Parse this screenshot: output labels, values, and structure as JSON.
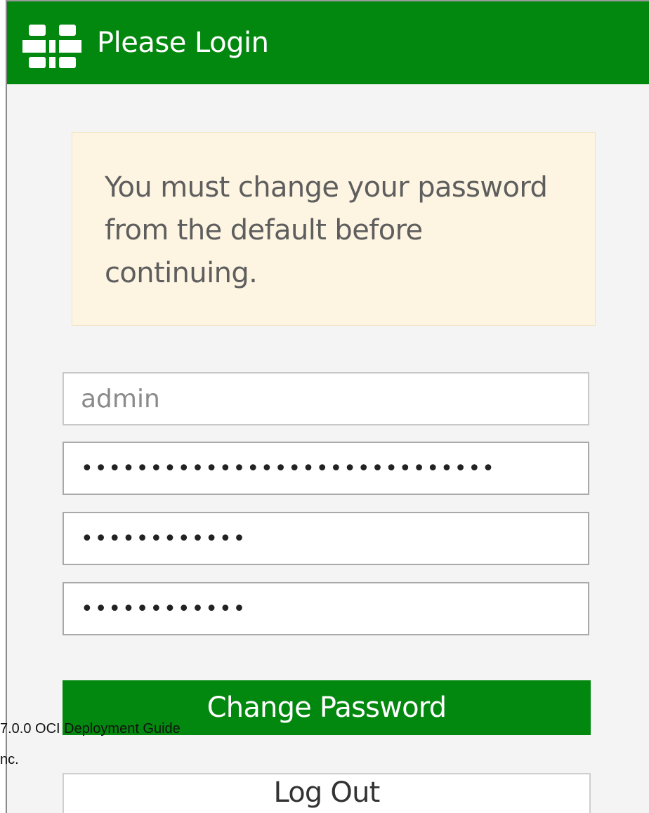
{
  "header": {
    "title": "Please Login",
    "logo_icon": "fortinet-logo-icon",
    "background_color": "#03880f"
  },
  "alert": {
    "message": "You must change your password from the default before continuing.",
    "background_color": "#fdf4e1"
  },
  "form": {
    "username_value": "admin",
    "old_password_value": "••••••••••••••••••••••••••••••",
    "new_password_value": "••••••••••••",
    "confirm_password_value": "••••••••••••"
  },
  "buttons": {
    "change_password_label": "Change Password",
    "logout_label": "Log Out",
    "accent_color": "#03880f"
  },
  "document_footer": {
    "line1": "7.0.0 OCI Deployment Guide",
    "line2": "nc."
  }
}
